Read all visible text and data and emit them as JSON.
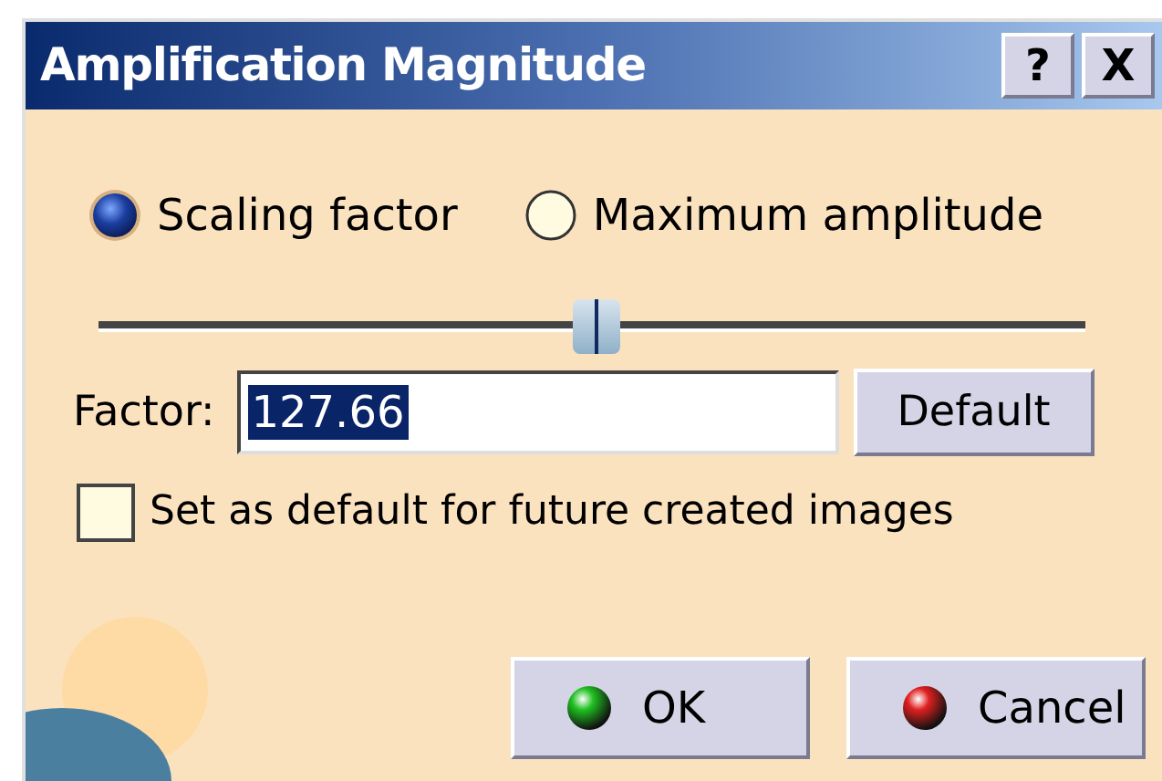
{
  "window": {
    "title": "Amplification Magnitude",
    "title_buttons": [
      "?",
      "X"
    ]
  },
  "mode_options": [
    {
      "label": "Scaling factor",
      "selected": true
    },
    {
      "label": "Maximum amplitude",
      "selected": false
    }
  ],
  "slider": {
    "level": 0.505
  },
  "factor": {
    "label": "Factor:",
    "value": "127.66",
    "value_highlighted": true,
    "button": "Default"
  },
  "set_default": {
    "label": "Set as default for future created images",
    "checked": false
  },
  "buttons": [
    {
      "label": "OK",
      "kind": "ok"
    },
    {
      "label": "Cancel",
      "kind": "cancel"
    }
  ]
}
